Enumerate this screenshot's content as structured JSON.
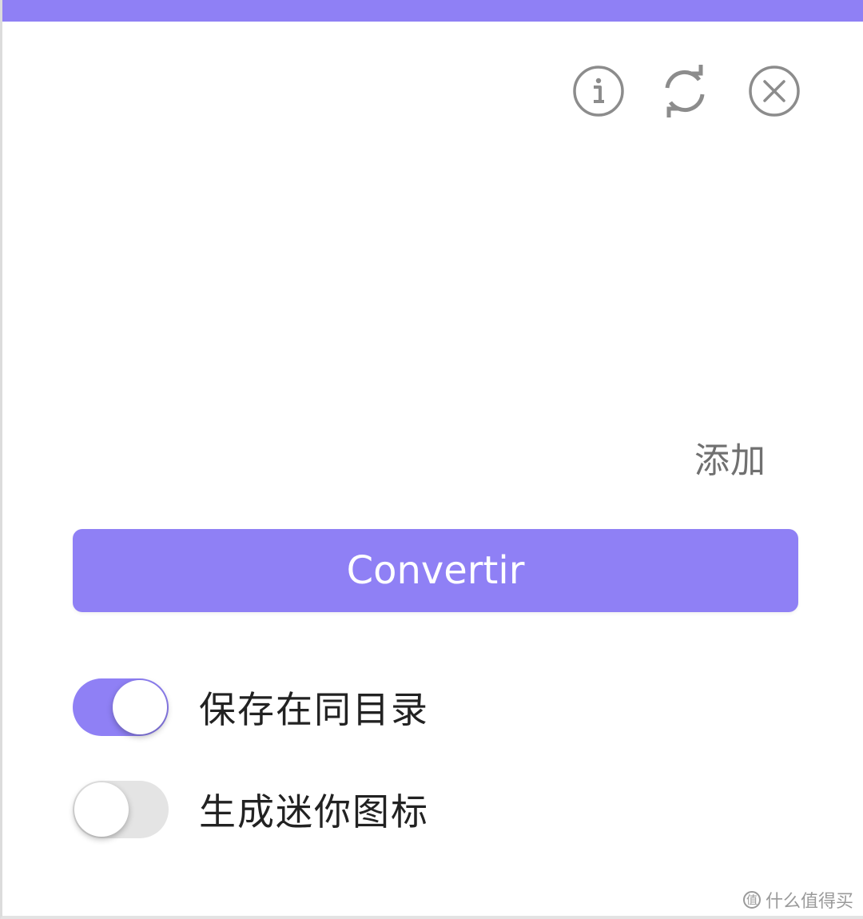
{
  "colors": {
    "accent": "#8f80f5",
    "icon_stroke": "#8c8c8c",
    "add_text": "#707070",
    "toggle_off_track": "#e4e4e4",
    "watermark": "#9a9a9a"
  },
  "header": {
    "icons": [
      {
        "name": "info-icon"
      },
      {
        "name": "refresh-icon"
      },
      {
        "name": "close-icon"
      }
    ]
  },
  "add_label": "添加",
  "convert": {
    "label": "Convertir"
  },
  "options": [
    {
      "label": "保存在同目录",
      "enabled": true
    },
    {
      "label": "生成迷你图标",
      "enabled": false
    }
  ],
  "watermark": {
    "icon_glyph": "值",
    "text": "什么值得买"
  }
}
